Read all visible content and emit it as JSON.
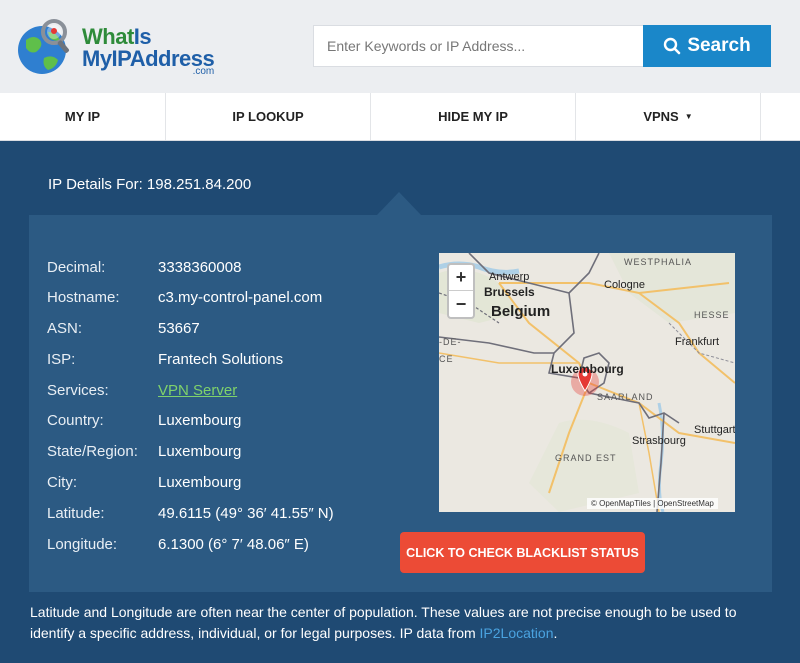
{
  "header": {
    "logo": {
      "line1a": "What",
      "line1b": "Is",
      "line2": "MyIPAddress",
      "line3": ".com"
    },
    "search": {
      "placeholder": "Enter Keywords or IP Address...",
      "value": "",
      "button_label": "Search",
      "icon": "search-icon"
    }
  },
  "nav": {
    "items": [
      {
        "label": "MY IP"
      },
      {
        "label": "IP LOOKUP"
      },
      {
        "label": "HIDE MY IP"
      },
      {
        "label": "VPNS",
        "caret": "▼"
      }
    ]
  },
  "details": {
    "title": "IP Details For: 198.251.84.200",
    "rows": [
      {
        "label": "Decimal:",
        "value": "3338360008"
      },
      {
        "label": "Hostname:",
        "value": "c3.my-control-panel.com"
      },
      {
        "label": "ASN:",
        "value": "53667"
      },
      {
        "label": "ISP:",
        "value": "Frantech Solutions"
      },
      {
        "label": "Services:",
        "value": "VPN Server"
      },
      {
        "label": "Country:",
        "value": "Luxembourg"
      },
      {
        "label": "State/Region:",
        "value": "Luxembourg"
      },
      {
        "label": "City:",
        "value": "Luxembourg"
      },
      {
        "label": "Latitude:",
        "value": "49.6115  (49° 36′ 41.55″ N)"
      },
      {
        "label": "Longitude:",
        "value": "6.1300  (6° 7′ 48.06″ E)"
      }
    ]
  },
  "map": {
    "zoom_in": "+",
    "zoom_out": "−",
    "labels": {
      "antwerp": "Antwerp",
      "westphalia": "WESTPHALIA",
      "brussels": "Brussels",
      "cologne": "Cologne",
      "belgium": "Belgium",
      "hesse": "HESSE",
      "de": "-DE-",
      "ce": "CE",
      "frankfurt": "Frankfurt",
      "luxembourg": "Luxembourg",
      "saarland": "SAARLAND",
      "strasbourg": "Strasbourg",
      "stuttgart": "Stuttgart",
      "grand_est": "GRAND EST",
      "attribution": "© OpenMapTiles | OpenStreetMap"
    },
    "colors": {
      "land": "#e9e6df",
      "border": "#6f6f7a",
      "road": "#f2c16a",
      "water": "#aed0e6",
      "marker": "#e53935"
    }
  },
  "blacklist_button": "CLICK TO CHECK BLACKLIST STATUS",
  "footnote": {
    "text": "Latitude and Longitude are often near the center of population. These values are not precise enough to be used to identify a specific address, individual, or for legal purposes. IP data from ",
    "link": "IP2Location",
    "end": "."
  }
}
